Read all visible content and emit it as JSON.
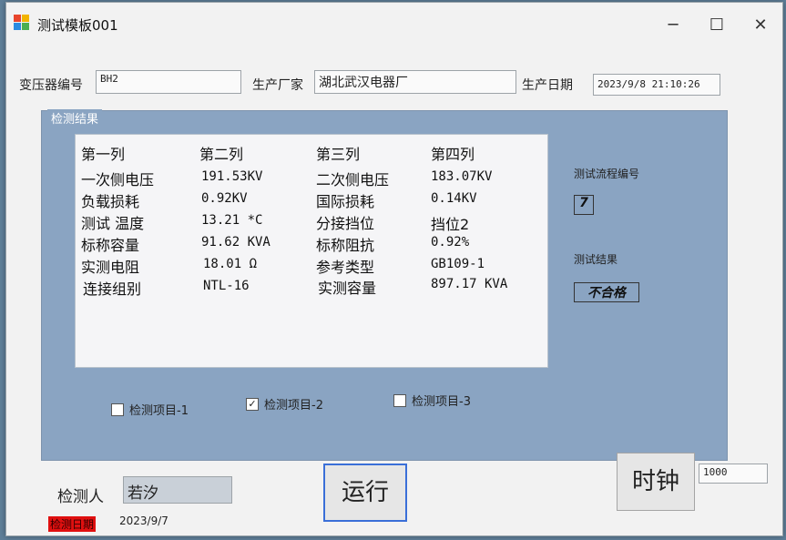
{
  "window": {
    "title": "测试模板001",
    "controls": {
      "minimize": "─",
      "maximize": "☐",
      "close": "✕"
    }
  },
  "header": {
    "transformer_id_label": "变压器编号",
    "transformer_id_value": "BH2",
    "manufacturer_label": "生产厂家",
    "manufacturer_value": "湖北武汉电器厂",
    "production_date_label": "生产日期",
    "production_date_value": "2023/9/8 21:10:26"
  },
  "results": {
    "group_title": "检测结果",
    "rows": [
      [
        "第一列",
        "第二列",
        "第三列",
        "第四列"
      ],
      [
        "一次侧电压",
        "191.53KV",
        "二次侧电压",
        "183.07KV"
      ],
      [
        "负载损耗",
        "0.92KV",
        "国际损耗",
        "0.14KV"
      ],
      [
        "测试 温度",
        "13.21 *C",
        "分接挡位",
        "挡位2"
      ],
      [
        "标称容量",
        "91.62 KVA",
        "标称阻抗",
        "0.92%"
      ],
      [
        "实测电阻",
        "18.01 Ω",
        "参考类型",
        "GB109-1"
      ],
      [
        "连接组别",
        "NTL-16",
        "实测容量",
        "897.17 KVA"
      ]
    ],
    "process_id_label": "测试流程编号",
    "process_id_value": "7",
    "test_result_label": "测试结果",
    "test_result_value": "不合格",
    "checkboxes": [
      {
        "label": "检测项目-1",
        "checked": false
      },
      {
        "label": "检测项目-2",
        "checked": true
      },
      {
        "label": "检测项目-3",
        "checked": false
      }
    ]
  },
  "footer": {
    "inspector_label": "检测人",
    "inspector_value": "若汐",
    "inspection_date_label": "检测日期",
    "inspection_date_value": "2023/9/7",
    "run_button": "运行",
    "clock_button": "时钟",
    "interval_value": "1000"
  },
  "colors": {
    "group_bg": "#8aa4c2",
    "date_label_bg": "#e01010",
    "run_border": "#3a6fd8"
  }
}
